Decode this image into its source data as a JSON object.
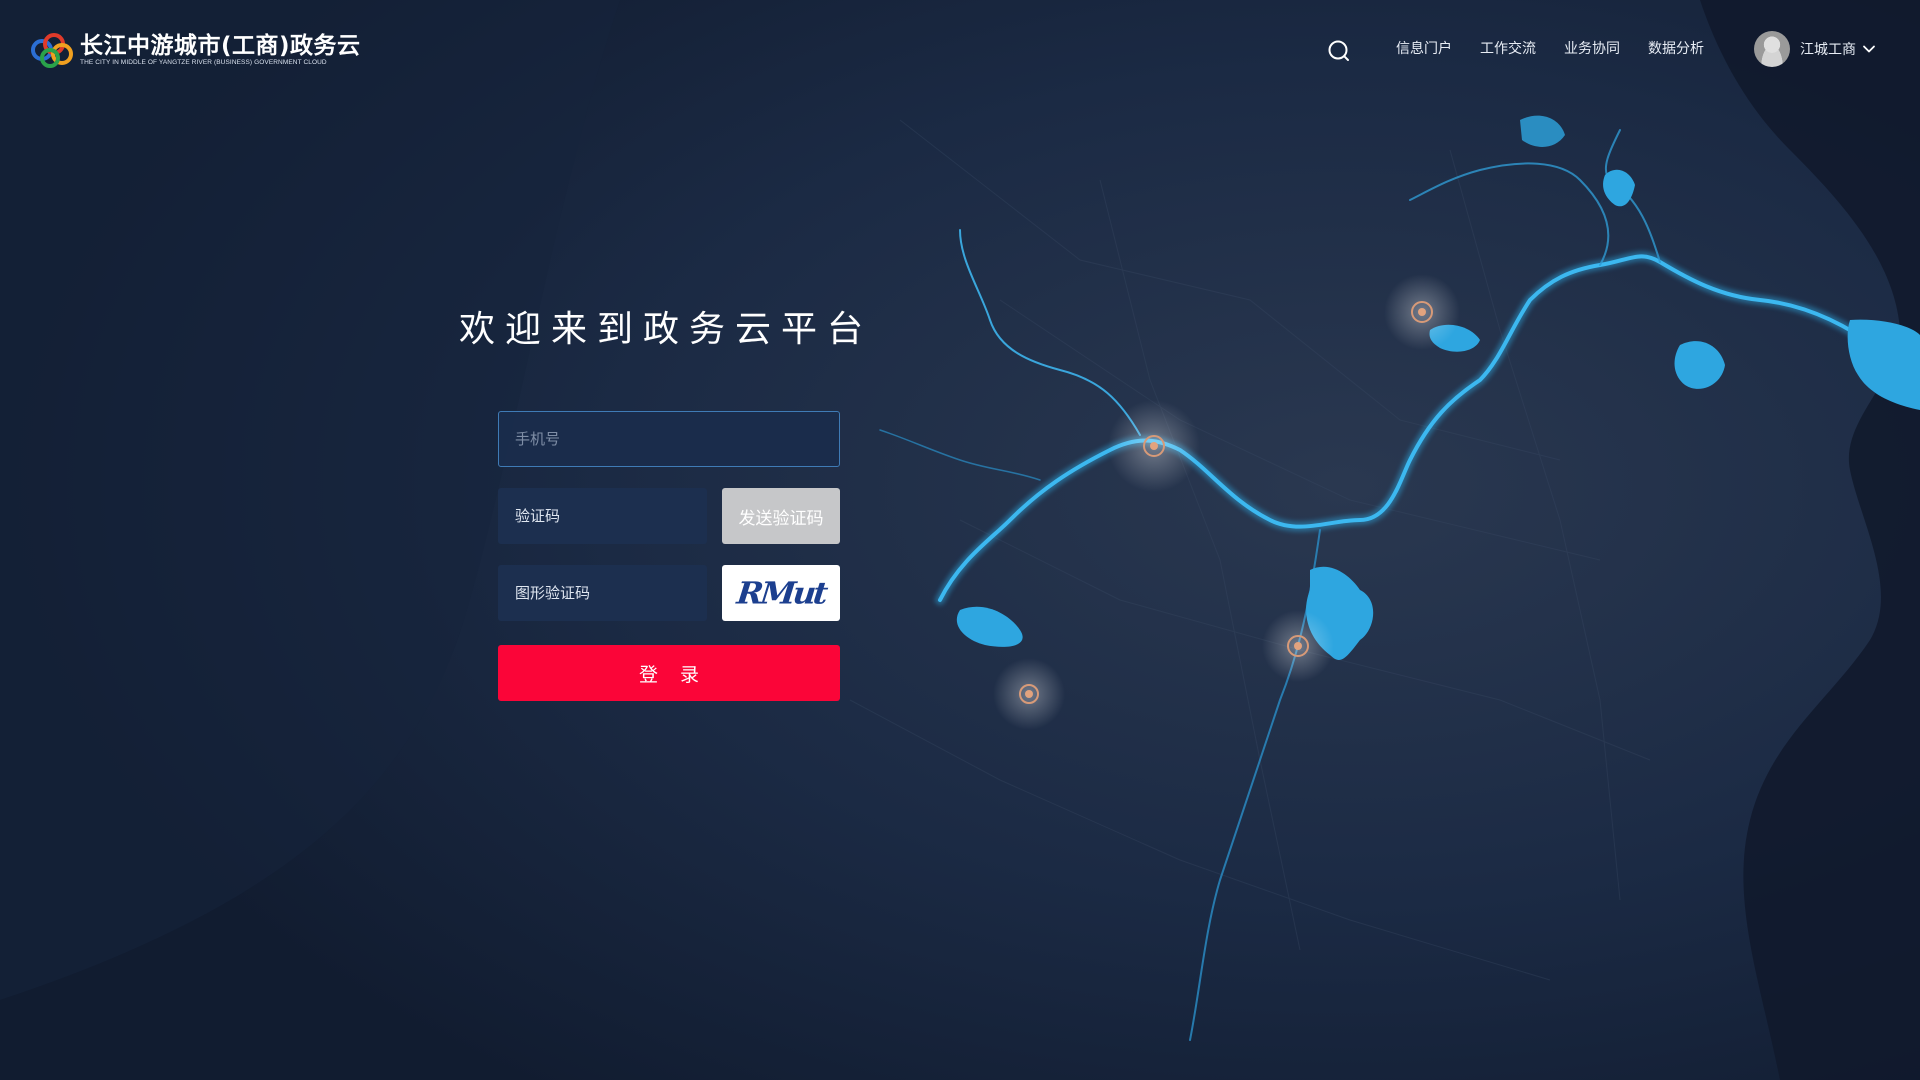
{
  "header": {
    "logo_title": "长江中游城市(工商)政务云",
    "logo_subtitle": "THE CITY IN MIDDLE OF YANGTZE RIVER (BUSINESS) GOVERNMENT CLOUD",
    "nav": [
      "信息门户",
      "工作交流",
      "业务协同",
      "数据分析"
    ],
    "user_name": "江城工商"
  },
  "login": {
    "welcome": "欢迎来到政务云平台",
    "phone_placeholder": "手机号",
    "code_placeholder": "验证码",
    "send_code_label": "发送验证码",
    "captcha_placeholder": "图形验证码",
    "captcha_text": "RMut",
    "login_label": "登 录"
  },
  "colors": {
    "background": "#142036",
    "river": "#2fa8e0",
    "login_button": "#fb0538",
    "send_button": "#c6c7c9",
    "input_bg": "#1c3050"
  },
  "icons": [
    "logo-mark-icon",
    "search-icon",
    "avatar-icon",
    "chevron-down-icon",
    "map-marker-icon"
  ]
}
